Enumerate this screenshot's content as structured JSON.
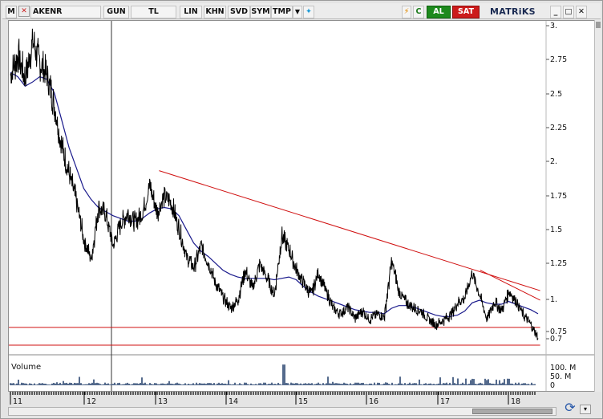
{
  "toolbar": {
    "menu_icon": "M",
    "tool_icon": "crosshair-x-icon",
    "symbol": "AKENR",
    "period": "GUN",
    "currency": "TL",
    "scale": "LIN",
    "khn": "KHN",
    "svd": "SVD",
    "sym": "SYM",
    "tmp": "TMP",
    "alarm_icon": "⚡",
    "refresh_icon": "C",
    "buy": "AL",
    "sell": "SAT",
    "brand": "MATRiKS",
    "win_min": "_",
    "win_max": "□",
    "win_close": "✕"
  },
  "chart": {
    "volume_label": "Volume",
    "volume_ticks": [
      "100. M",
      "50. M",
      "0"
    ],
    "price_ticks": [
      "3.",
      "2.75",
      "2.5",
      "2.25",
      "2.",
      "1.75",
      "1.5",
      "1.25",
      "1.",
      "0.75",
      "0.7"
    ],
    "year_labels": [
      "11",
      "12",
      "13",
      "14",
      "15",
      "16",
      "17",
      "18"
    ],
    "colors": {
      "price": "#000000",
      "ma": "#1a1a8c",
      "trend": "#d01010",
      "volume": "#0a2a5a",
      "cursor": "#333333"
    }
  },
  "chart_data": {
    "type": "line",
    "title": "",
    "xlabel": "",
    "ylabel": "",
    "ylim": [
      0.62,
      3.0
    ],
    "x_labels": [
      "11",
      "12",
      "13",
      "14",
      "15",
      "16",
      "17",
      "18"
    ],
    "series": [
      {
        "values": [
          2.63,
          2.78,
          2.6,
          2.88,
          2.72,
          2.62,
          2.4,
          2.1,
          1.9,
          1.7,
          1.42,
          1.28,
          1.67,
          1.6,
          1.38,
          1.54,
          1.62,
          1.55,
          1.62,
          1.82,
          1.62,
          1.75,
          1.68,
          1.5,
          1.3,
          1.22,
          1.38,
          1.25,
          1.1,
          1.0,
          0.92,
          0.98,
          1.2,
          1.06,
          1.25,
          1.14,
          1.02,
          1.45,
          1.35,
          1.2,
          1.1,
          1.02,
          1.18,
          1.05,
          0.92,
          0.88,
          0.93,
          0.85,
          0.9,
          0.84,
          0.88,
          0.86,
          1.27,
          1.04,
          0.96,
          0.92,
          0.9,
          0.84,
          0.8,
          0.83,
          0.87,
          0.96,
          1.0,
          1.18,
          1.02,
          0.84,
          0.97,
          0.9,
          1.05,
          0.97,
          0.87,
          0.8,
          0.7
        ]
      },
      {
        "values": [
          2.65,
          2.62,
          2.55,
          2.58,
          2.62,
          2.6,
          2.5,
          2.3,
          2.1,
          1.95,
          1.8,
          1.72,
          1.66,
          1.63,
          1.6,
          1.58,
          1.56,
          1.56,
          1.58,
          1.62,
          1.65,
          1.66,
          1.65,
          1.6,
          1.5,
          1.4,
          1.34,
          1.3,
          1.25,
          1.2,
          1.17,
          1.15,
          1.14,
          1.14,
          1.14,
          1.14,
          1.13,
          1.14,
          1.15,
          1.13,
          1.08,
          1.04,
          1.01,
          0.99,
          0.97,
          0.95,
          0.93,
          0.91,
          0.9,
          0.89,
          0.89,
          0.88,
          0.92,
          0.94,
          0.94,
          0.93,
          0.91,
          0.89,
          0.87,
          0.86,
          0.86,
          0.87,
          0.9,
          0.96,
          0.98,
          0.96,
          0.95,
          0.95,
          0.97,
          0.95,
          0.93,
          0.91,
          0.88
        ]
      }
    ],
    "trendlines": [
      {
        "from": [
          13.05,
          1.93
        ],
        "to": [
          18.45,
          1.05
        ]
      },
      {
        "from": [
          17.6,
          1.2
        ],
        "to": [
          18.45,
          0.98
        ]
      },
      {
        "from": [
          10.95,
          0.78
        ],
        "to": [
          18.45,
          0.78
        ]
      },
      {
        "from": [
          10.95,
          0.65
        ],
        "to": [
          18.45,
          0.65
        ]
      }
    ],
    "volume_max": 120
  }
}
